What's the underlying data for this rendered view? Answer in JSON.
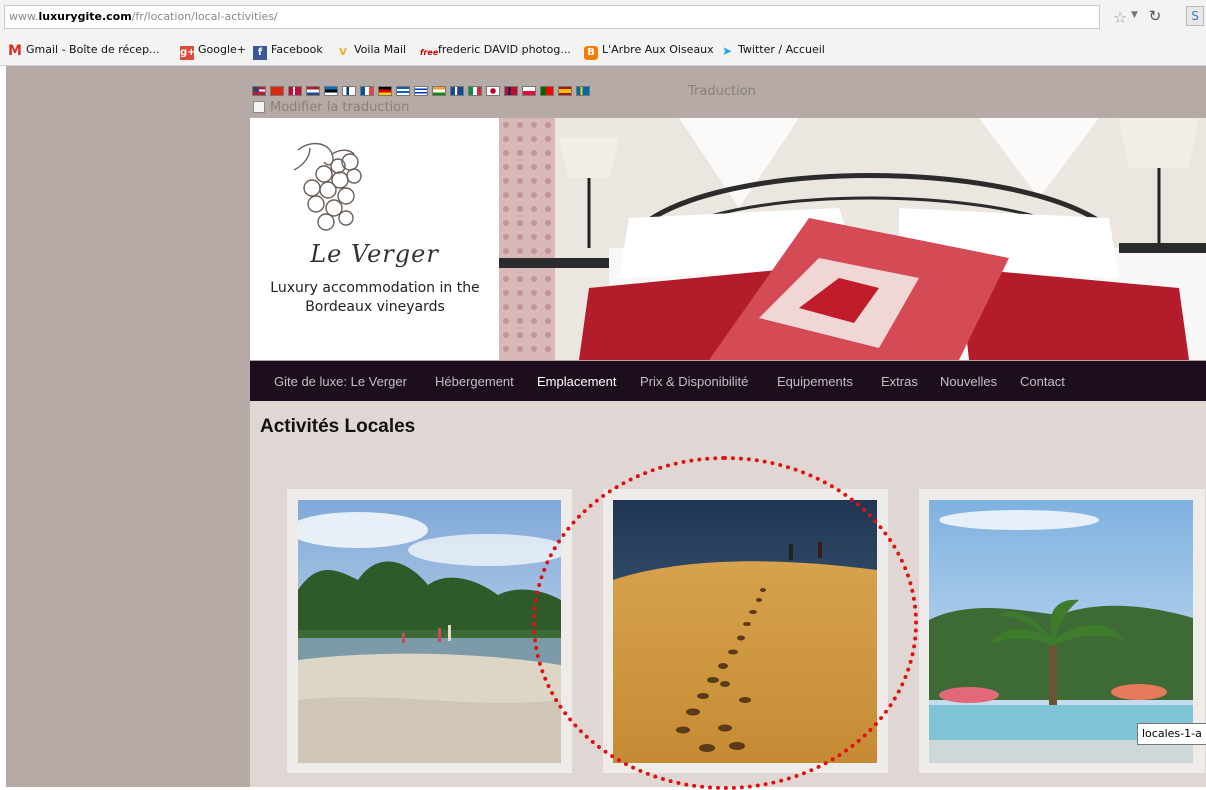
{
  "browser": {
    "url_host": "www.luxurygite.com",
    "url_path": "/fr/location/local-activities/",
    "url_prefix": "www.",
    "url_domain": "luxurygite.com"
  },
  "bookmarks": [
    {
      "label": "Gmail - Boîte de récep...",
      "icon": "gmail-icon",
      "color": "#d93025"
    },
    {
      "label": "Google+",
      "icon": "googleplus-icon",
      "color": "#dd4b39"
    },
    {
      "label": "Facebook",
      "icon": "facebook-icon",
      "color": "#3b5998"
    },
    {
      "label": "Voila Mail",
      "icon": "voila-icon",
      "color": "#f5a623"
    },
    {
      "label": "frederic DAVID photog...",
      "icon": "free-icon",
      "color": "#cc0000"
    },
    {
      "label": "L'Arbre Aux Oiseaux",
      "icon": "blogger-icon",
      "color": "#f57d00"
    },
    {
      "label": "Twitter / Accueil",
      "icon": "twitter-icon",
      "color": "#1da1f2"
    }
  ],
  "translation": {
    "label": "Traduction",
    "modify_label": "Modifier la traduction"
  },
  "site": {
    "name": "Le Verger",
    "tagline": "Luxury accommodation in the Bordeaux vineyards"
  },
  "nav": [
    {
      "label": "Gite de luxe: Le Verger",
      "active": false
    },
    {
      "label": "Hébergement",
      "active": false
    },
    {
      "label": "Emplacement",
      "active": true
    },
    {
      "label": "Prix & Disponibilité",
      "active": false
    },
    {
      "label": "Equipements",
      "active": false
    },
    {
      "label": "Extras",
      "active": false
    },
    {
      "label": "Nouvelles",
      "active": false
    },
    {
      "label": "Contact",
      "active": false
    }
  ],
  "page": {
    "title": "Activités Locales"
  },
  "gallery": [
    {
      "subject": "beach-lake-photo"
    },
    {
      "subject": "sand-dune-photo"
    },
    {
      "subject": "pool-palm-photo"
    }
  ],
  "tooltip": {
    "text": "locales-1-a"
  },
  "colors": {
    "nav_bg": "#1c0e1c",
    "page_bg": "#b6aaa6",
    "content_bg": "#e0d6d3",
    "highlight": "#e0100f"
  }
}
